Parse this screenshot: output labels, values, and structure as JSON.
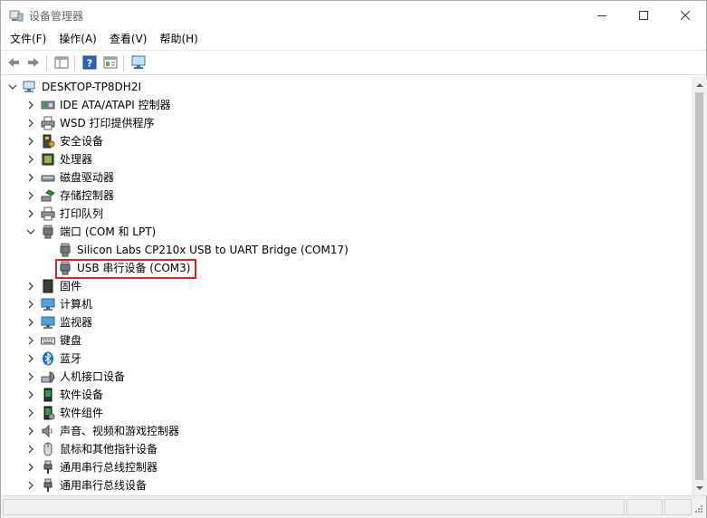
{
  "window": {
    "title": "设备管理器"
  },
  "menu": [
    "文件(F)",
    "操作(A)",
    "查看(V)",
    "帮助(H)"
  ],
  "tree": {
    "root": "DESKTOP-TP8DH2I",
    "items": [
      {
        "label": "IDE ATA/ATAPI 控制器",
        "icon": "ide-controller-icon",
        "expanded": false
      },
      {
        "label": "WSD 打印提供程序",
        "icon": "printer-icon",
        "expanded": false
      },
      {
        "label": "安全设备",
        "icon": "security-device-icon",
        "expanded": false
      },
      {
        "label": "处理器",
        "icon": "processor-icon",
        "expanded": false
      },
      {
        "label": "磁盘驱动器",
        "icon": "disk-drive-icon",
        "expanded": false
      },
      {
        "label": "存储控制器",
        "icon": "storage-controller-icon",
        "expanded": false
      },
      {
        "label": "打印队列",
        "icon": "printer-icon",
        "expanded": false
      },
      {
        "label": "端口 (COM 和 LPT)",
        "icon": "port-icon",
        "expanded": true,
        "children": [
          {
            "label": "Silicon Labs CP210x USB to UART Bridge (COM17)",
            "icon": "port-icon"
          },
          {
            "label": "USB 串行设备 (COM3)",
            "icon": "port-icon",
            "highlighted": true
          }
        ]
      },
      {
        "label": "固件",
        "icon": "firmware-icon",
        "expanded": false
      },
      {
        "label": "计算机",
        "icon": "computer-icon",
        "expanded": false
      },
      {
        "label": "监视器",
        "icon": "monitor-icon",
        "expanded": false
      },
      {
        "label": "键盘",
        "icon": "keyboard-icon",
        "expanded": false
      },
      {
        "label": "蓝牙",
        "icon": "bluetooth-icon",
        "expanded": false
      },
      {
        "label": "人机接口设备",
        "icon": "hid-icon",
        "expanded": false
      },
      {
        "label": "软件设备",
        "icon": "software-device-icon",
        "expanded": false
      },
      {
        "label": "软件组件",
        "icon": "software-component-icon",
        "expanded": false
      },
      {
        "label": "声音、视频和游戏控制器",
        "icon": "audio-icon",
        "expanded": false
      },
      {
        "label": "鼠标和其他指针设备",
        "icon": "mouse-icon",
        "expanded": false
      },
      {
        "label": "通用串行总线控制器",
        "icon": "usb-icon",
        "expanded": false
      },
      {
        "label": "通用串行总线设备",
        "icon": "usb-icon",
        "expanded": false
      }
    ]
  },
  "colors": {
    "highlight_border": "#d9232e",
    "selection": "#cce8ff"
  }
}
